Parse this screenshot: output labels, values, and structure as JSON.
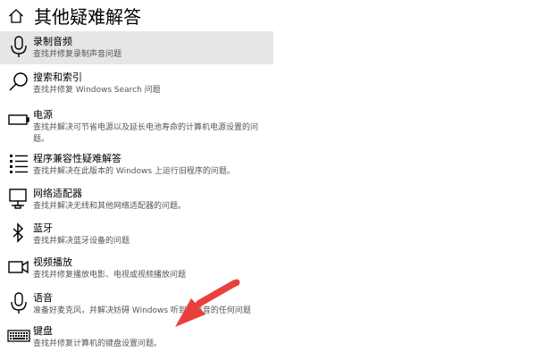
{
  "page": {
    "title": "其他疑难解答"
  },
  "colors": {
    "selected_bg": "#e6e6e6",
    "annotation_arrow": "#e8413b"
  },
  "items": [
    {
      "icon": "microphone-icon",
      "title": "录制音频",
      "desc": "查找并修复录制声音问题"
    },
    {
      "icon": "search-icon",
      "title": "搜索和索引",
      "desc": "查找并修复 Windows Search 问题"
    },
    {
      "icon": "battery-icon",
      "title": "电源",
      "desc": "查找并解决可节省电源以及延长电池寿命的计算机电源设置的问题。"
    },
    {
      "icon": "program-list-icon",
      "title": "程序兼容性疑难解答",
      "desc": "查找并解决在此版本的 Windows 上运行旧程序的问题。"
    },
    {
      "icon": "network-adapter-icon",
      "title": "网络适配器",
      "desc": "查找并解决无线和其他网络适配器的问题。"
    },
    {
      "icon": "bluetooth-icon",
      "title": "蓝牙",
      "desc": "查找并解决蓝牙设备的问题"
    },
    {
      "icon": "video-camera-icon",
      "title": "视频播放",
      "desc": "查找并修复播放电影、电视或视频播放问题"
    },
    {
      "icon": "microphone-icon",
      "title": "语音",
      "desc": "准备好麦克风，并解决妨碍 Windows 听到你声音的任何问题"
    },
    {
      "icon": "keyboard-icon",
      "title": "键盘",
      "desc": "查找并修复计算机的键盘设置问题。"
    }
  ]
}
